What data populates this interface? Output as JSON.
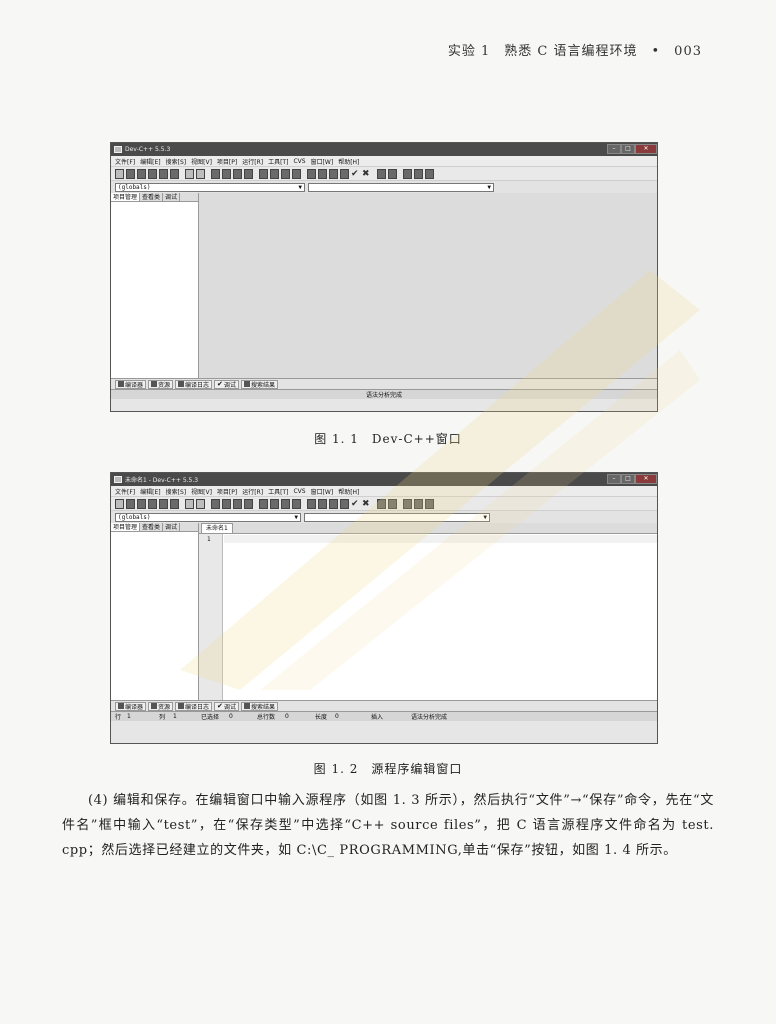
{
  "running_head": "实验 1　熟悉 C 语言编程环境　•　003",
  "figure1": {
    "title": "Dev-C++ 5.5.3",
    "menu": [
      "文件[F]",
      "编辑[E]",
      "搜索[S]",
      "视图[V]",
      "项目[P]",
      "运行[R]",
      "工具[T]",
      "CVS",
      "窗口[W]",
      "帮助[H]"
    ],
    "combo1": "(globals)",
    "left_tabs": [
      "项目管理",
      "查看类",
      "调试"
    ],
    "bottom_tabs": [
      "编译器",
      "资源",
      "编译日志",
      "调试",
      "搜索结果"
    ],
    "status": "语法分析完成",
    "caption": "图 1. 1　Dev-C++窗口"
  },
  "figure2": {
    "title": "未命名1 - Dev-C++ 5.5.3",
    "menu": [
      "文件[F]",
      "编辑[E]",
      "搜索[S]",
      "视图[V]",
      "项目[P]",
      "运行[R]",
      "工具[T]",
      "CVS",
      "窗口[W]",
      "帮助[H]"
    ],
    "combo1": "(globals)",
    "left_tabs": [
      "项目管理",
      "查看类",
      "调试"
    ],
    "editor_tab": "未命名1",
    "line_number": "1",
    "bottom_tabs": [
      "编译器",
      "资源",
      "编译日志",
      "调试",
      "搜索结果"
    ],
    "status": {
      "row_label": "行",
      "row_value": "1",
      "col_label": "列",
      "col_value": "1",
      "sel_label": "已选择",
      "sel_value": "0",
      "lines_label": "总行数",
      "lines_value": "0",
      "len_label": "长度",
      "len_value": "0",
      "mode": "插入",
      "message": "语法分析完成"
    },
    "caption": "图 1. 2　源程序编辑窗口"
  },
  "paragraph": "(4) 编辑和保存。在编辑窗口中输入源程序（如图 1. 3 所示），然后执行“文件”→“保存”命令，先在“文件名”框中输入“test”，在“保存类型”中选择“C++ source files”，把 C 语言源程序文件命名为 test. cpp；然后选择已经建立的文件夹，如 C:\\C_ PROGRAMMING,单击“保存”按钮，如图 1. 4 所示。"
}
